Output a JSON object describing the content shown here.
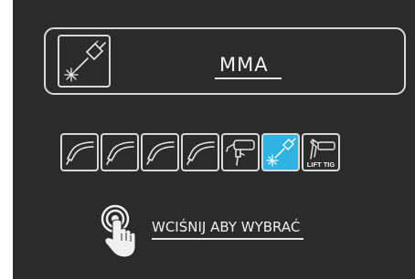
{
  "mode": {
    "label": "MMA",
    "icon": "electrode-holder-spark-icon"
  },
  "process_buttons": [
    {
      "icon": "mig-torch-icon",
      "selected": false
    },
    {
      "icon": "mig-torch-icon",
      "selected": false
    },
    {
      "icon": "mig-torch-icon",
      "selected": false
    },
    {
      "icon": "mig-torch-icon",
      "selected": false
    },
    {
      "icon": "spool-gun-icon",
      "selected": false
    },
    {
      "icon": "electrode-holder-spark-icon",
      "selected": true
    },
    {
      "icon": "tig-torch-icon",
      "selected": false,
      "label": "LIFT TIG"
    }
  ],
  "hint": {
    "text": "WCIŚNIJ ABY WYBRAĆ",
    "icon": "press-finger-icon"
  },
  "colors": {
    "background": "#2b2b2b",
    "frame": "#d8d8d8",
    "selected": "#2fb3e3",
    "text": "#f2f2f2"
  }
}
